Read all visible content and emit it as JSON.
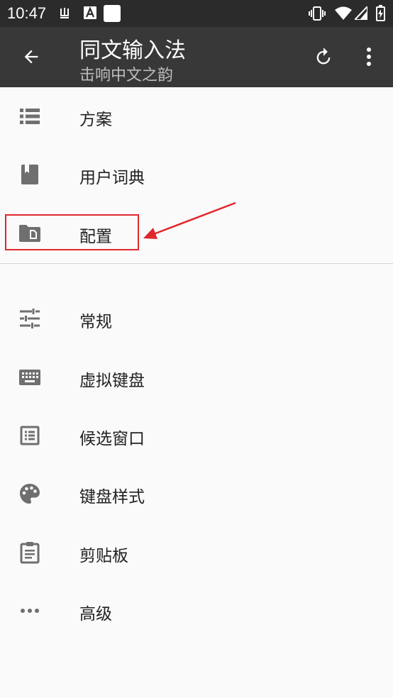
{
  "status_bar": {
    "time": "10:47",
    "left_icons": [
      "storage-icon",
      "a-icon",
      "square-icon"
    ],
    "right_icons": [
      "vibrate-icon",
      "wifi-icon",
      "signal-icon",
      "battery-icon"
    ]
  },
  "app_bar": {
    "title": "同文输入法",
    "subtitle": "击响中文之韵",
    "icons": [
      "back-arrow-icon",
      "refresh-icon",
      "more-vert-icon"
    ]
  },
  "menu": {
    "section1": [
      {
        "icon": "list-icon",
        "label": "方案"
      },
      {
        "icon": "book-icon",
        "label": "用户词典"
      },
      {
        "icon": "folder-file-icon",
        "label": "配置"
      }
    ],
    "section2": [
      {
        "icon": "tune-icon",
        "label": "常规"
      },
      {
        "icon": "keyboard-icon",
        "label": "虚拟键盘"
      },
      {
        "icon": "list-box-icon",
        "label": "候选窗口"
      },
      {
        "icon": "palette-icon",
        "label": "键盘样式"
      },
      {
        "icon": "clipboard-icon",
        "label": "剪贴板"
      },
      {
        "icon": "more-horiz-icon",
        "label": "高级"
      }
    ]
  },
  "colors": {
    "status_bar": "#2b2b2b",
    "app_bar": "#383838",
    "background": "#fafafa",
    "icon": "#6f6f6f",
    "annotation": "#e0272d"
  }
}
